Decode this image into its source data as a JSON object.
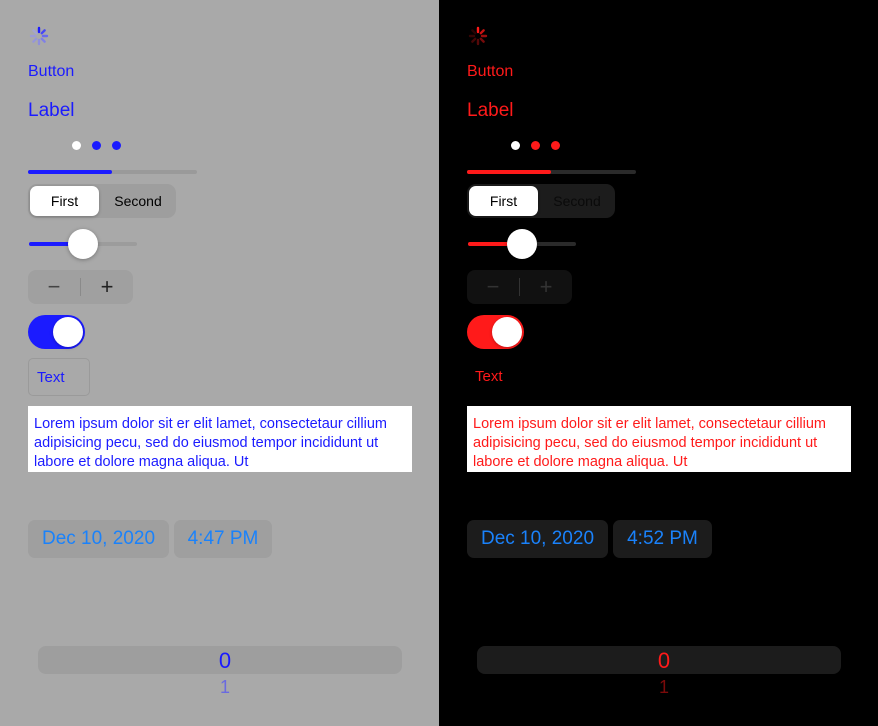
{
  "left": {
    "button_label": "Button",
    "label_text": "Label",
    "segments": [
      "First",
      "Second"
    ],
    "text_field_value": "Text",
    "text_view": "Lorem ipsum dolor sit er elit lamet, consectetaur cillium adipisicing pecu, sed do eiusmod tempor incididunt ut labore et dolore magna aliqua. Ut",
    "date": "Dec 10, 2020",
    "time": "4:47 PM",
    "picker_selected": "0",
    "picker_next": "1",
    "progress": 0.5,
    "slider": 0.5,
    "toggle_on": true,
    "page_count": 3,
    "current_page": 0,
    "accent_color": "#1b1bff"
  },
  "right": {
    "button_label": "Button",
    "label_text": "Label",
    "segments": [
      "First",
      "Second"
    ],
    "text_field_value": "Text",
    "text_view": "Lorem ipsum dolor sit er elit lamet, consectetaur cillium adipisicing pecu, sed do eiusmod tempor incididunt ut labore et dolore magna aliqua. Ut",
    "date": "Dec 10, 2020",
    "time": "4:52 PM",
    "picker_selected": "0",
    "picker_next": "1",
    "progress": 0.5,
    "slider": 0.5,
    "toggle_on": true,
    "page_count": 3,
    "current_page": 0,
    "accent_color": "#ff1a1a"
  }
}
